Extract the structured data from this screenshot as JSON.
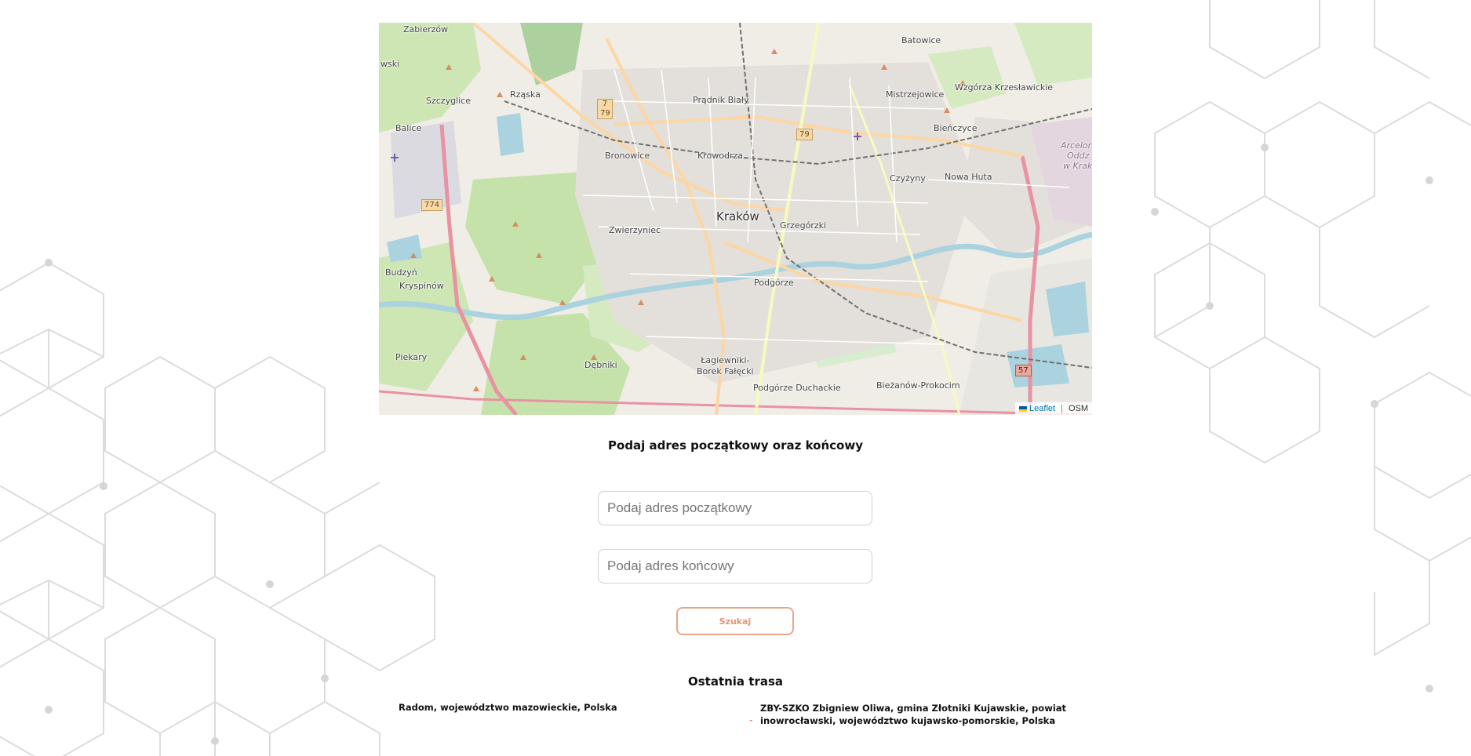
{
  "map": {
    "attribution": {
      "leaflet": "Leaflet",
      "separator": "|",
      "osm": "OSM"
    },
    "places": {
      "zabierzow": "Zabierzów",
      "batowice": "Batowice",
      "szczyglice": "Szczyglice",
      "rzaska": "Rząska",
      "pradnik_bialy": "Prądnik Biały",
      "mistrzejowice": "Mistrzejowice",
      "wzgorza": "Wzgórza Krzesławickie",
      "balice": "Balice",
      "bienczyce": "Bieńczyce",
      "arcelor_1": "Arcelor",
      "arcelor_2": "Oddz",
      "arcelor_3": "w Krak",
      "bronowice": "Bronowice",
      "krowodrza": "Krowodrza",
      "czyzyny": "Czyżyny",
      "nowa_huta": "Nowa Huta",
      "krakow": "Kraków",
      "grzegorzki": "Grzegórzki",
      "zwierzyniec": "Zwierzyniec",
      "budzyn": "Budzyń",
      "kryspinow": "Kryspinów",
      "podgorze": "Podgórze",
      "piekary": "Piekary",
      "debniki": "Dębniki",
      "lagiewniki_1": "Łagiewniki-",
      "lagiewniki_2": "Borek Fałęcki",
      "bierzanow": "Bieżanów-Prokocim",
      "podgorze_duchackie": "Podgórze Duchackie",
      "frag_wski": "wski"
    },
    "shields": {
      "r7": "7",
      "r79a": "79",
      "r79b": "79",
      "r774": "774",
      "r57": "57"
    }
  },
  "form": {
    "prompt": "Podaj adres początkowy oraz końcowy",
    "start_placeholder": "Podaj adres początkowy",
    "end_placeholder": "Podaj adres końcowy",
    "search_label": "Szukaj"
  },
  "last_route": {
    "title": "Ostatnia trasa",
    "from": "Radom, województwo mazowieckie, Polska",
    "separator": "-",
    "to": "ZBY-SZKO Zbigniew Oliwa, gmina Złotniki Kujawskie, powiat inowrocławski, województwo kujawsko-pomorskie, Polska"
  },
  "colors": {
    "accent": "#e29576",
    "link": "#0078a8",
    "flag_blue": "#0057b7",
    "flag_yellow": "#ffd700"
  }
}
